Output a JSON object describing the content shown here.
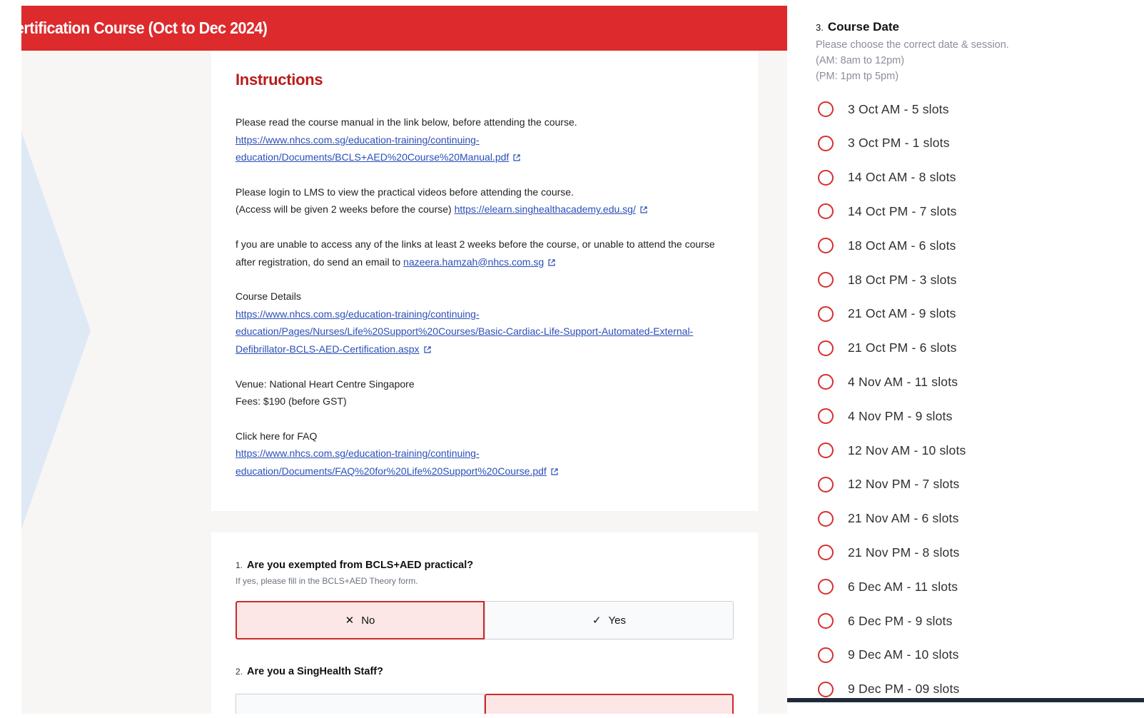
{
  "header": {
    "title": "ertification Course (Oct to Dec 2024)"
  },
  "instructions": {
    "title": "Instructions",
    "p1_text": "Please read the course manual in the link below, before attending the course.",
    "p1_link": "https://www.nhcs.com.sg/education-training/continuing-education/Documents/BCLS+AED%20Course%20Manual.pdf",
    "p2_text1": "Please login to LMS to view the practical videos before attending the course.",
    "p2_text2": "(Access will be given 2 weeks before the course)",
    "p2_link": "https://elearn.singhealthacademy.edu.sg/",
    "p3_text": "f you are unable to access any of the links at least 2 weeks before the course, or unable to attend the course after registration, do send an email to",
    "p3_email": "nazeera.hamzah@nhcs.com.sg",
    "p4_heading": "Course Details",
    "p4_link": "https://www.nhcs.com.sg/education-training/continuing-education/Pages/Nurses/Life%20Support%20Courses/Basic-Cardiac-Life-Support-Automated-External-Defibrillator-BCLS-AED-Certification.aspx",
    "venue": "Venue: National Heart Centre Singapore",
    "fees": "Fees: $190 (before GST)",
    "faq_heading": "Click here for FAQ",
    "faq_link": "https://www.nhcs.com.sg/education-training/continuing-education/Documents/FAQ%20for%20Life%20Support%20Course.pdf"
  },
  "q1": {
    "number": "1.",
    "title": "Are you exempted from BCLS+AED practical?",
    "help": "If yes, please fill in the BCLS+AED Theory form.",
    "no_glyph": "✕",
    "no_label": "No",
    "yes_glyph": "✓",
    "yes_label": "Yes"
  },
  "q2": {
    "number": "2.",
    "title": "Are you a SingHealth Staff?"
  },
  "q3": {
    "number": "3.",
    "title": "Course Date",
    "help1": "Please choose the correct date & session.",
    "help2": "(AM: 8am to 12pm)",
    "help3": "(PM: 1pm tp 5pm)",
    "options": [
      "3 Oct AM - 5 slots",
      "3 Oct PM - 1 slots",
      "14 Oct AM - 8 slots",
      "14 Oct PM - 7 slots",
      "18 Oct AM - 6 slots",
      "18 Oct PM - 3 slots",
      "21 Oct AM - 9 slots",
      "21 Oct PM - 6 slots",
      "4 Nov AM - 11 slots",
      "4 Nov PM - 9 slots",
      "12 Nov AM - 10 slots",
      "12 Nov PM - 7 slots",
      "21 Nov AM - 6 slots",
      "21 Nov PM - 8 slots",
      "6 Dec AM - 11 slots",
      "6 Dec PM - 9 slots",
      "9 Dec AM - 10 slots",
      "9 Dec PM - 09 slots"
    ]
  },
  "colors": {
    "header_red": "#dd2a2c",
    "title_red": "#b91c1c",
    "link_blue": "#2b4fb8",
    "radio_red": "#d62f2f",
    "selected_bg": "#fde6e6"
  }
}
